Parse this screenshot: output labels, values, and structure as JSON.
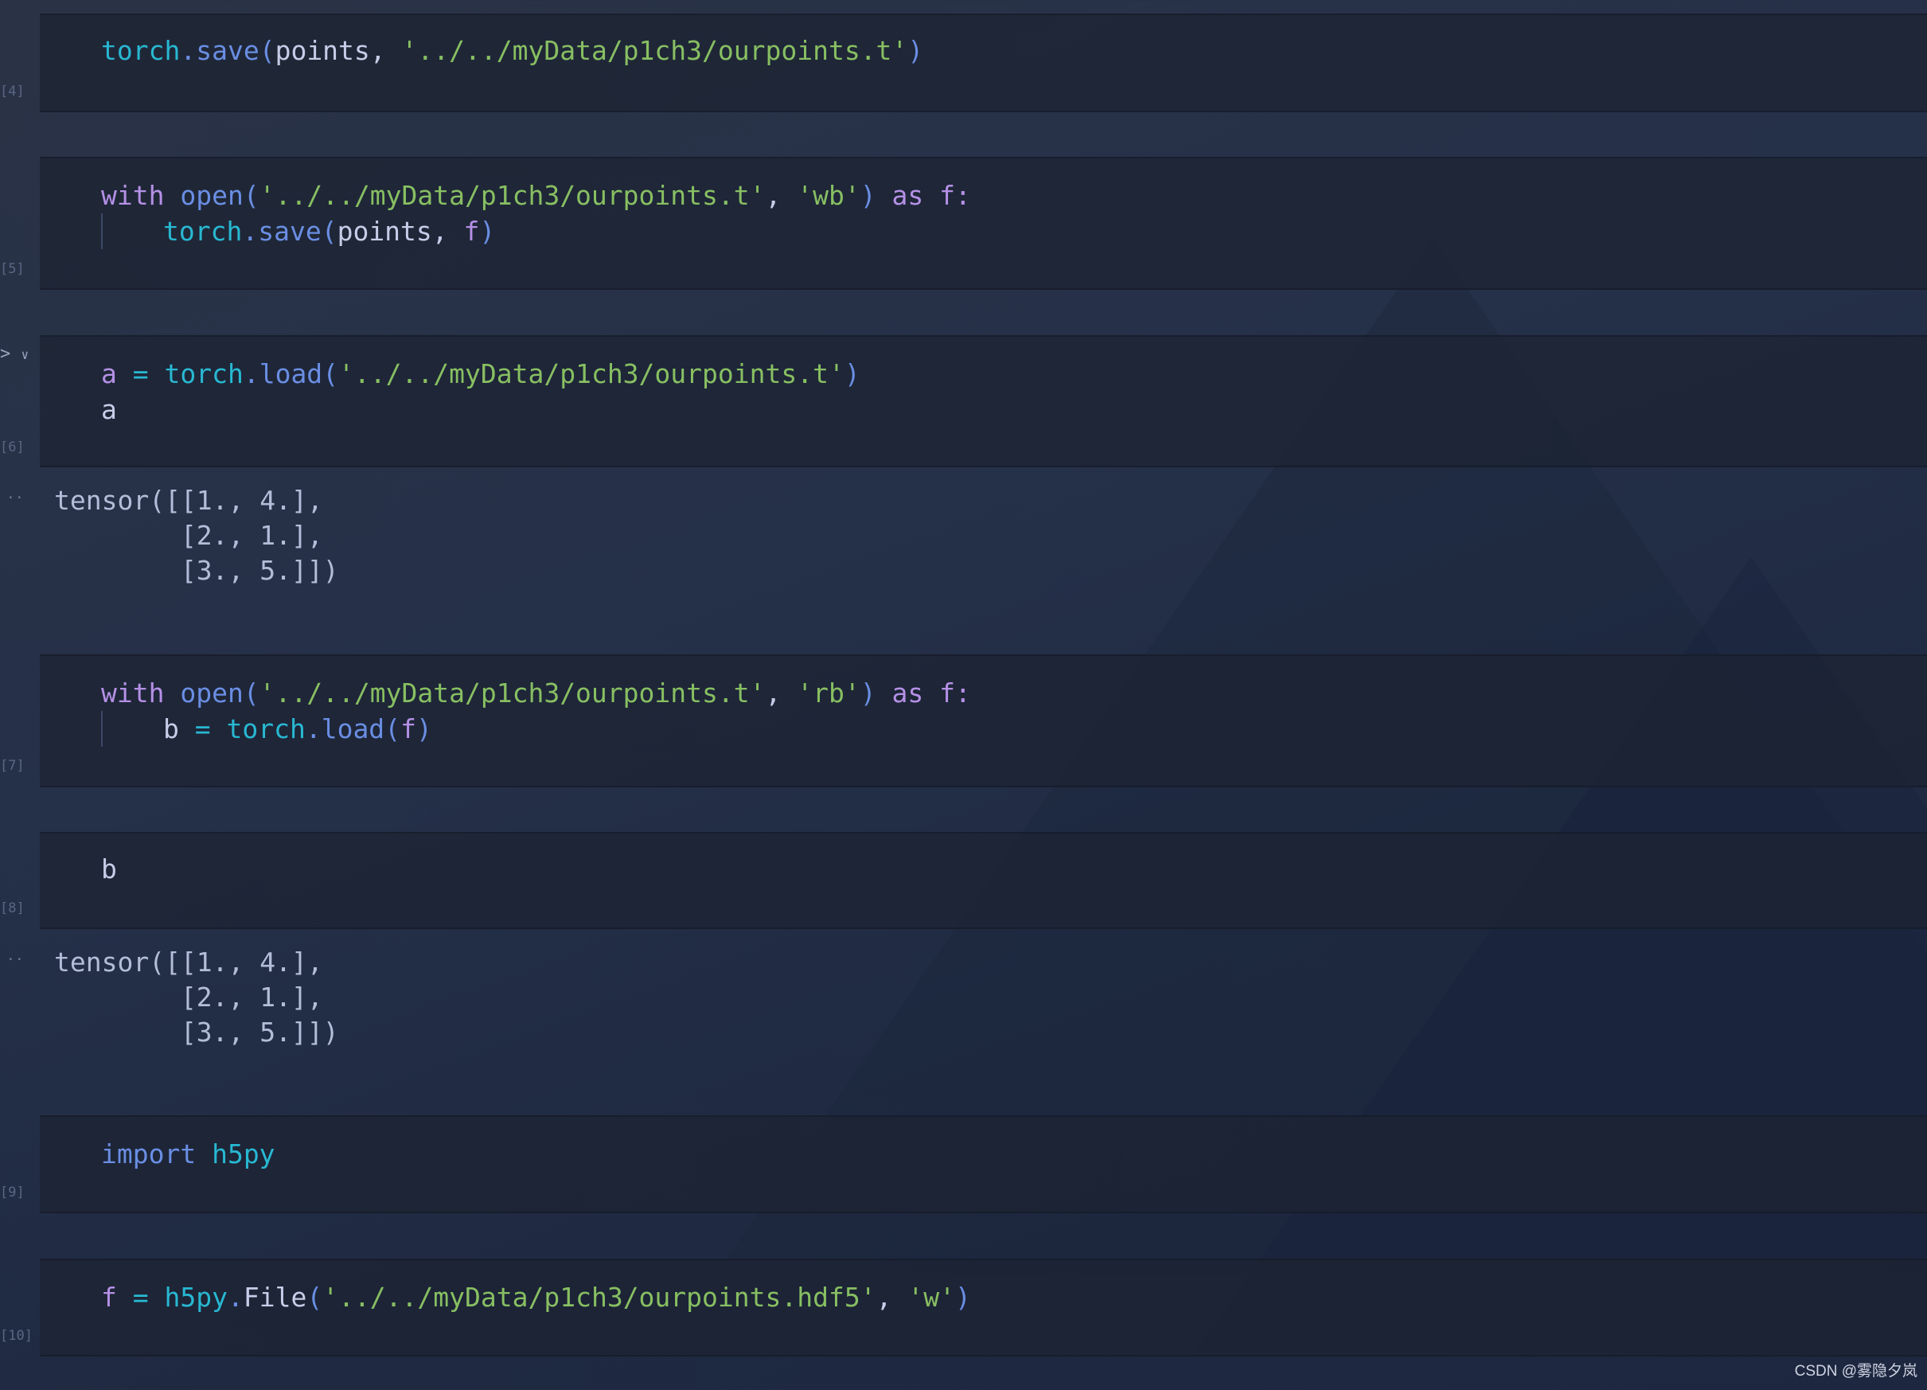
{
  "cells": [
    {
      "exec_count": "[4]",
      "lines": [
        [
          {
            "t": "torch",
            "c": "fn"
          },
          {
            "t": ".",
            "c": "meth"
          },
          {
            "t": "save",
            "c": "meth"
          },
          {
            "t": "(",
            "c": "punc"
          },
          {
            "t": "points, ",
            "c": "var"
          },
          {
            "t": "'../../myData/p1ch3/ourpoints.t'",
            "c": "str"
          },
          {
            "t": ")",
            "c": "punc"
          }
        ]
      ]
    },
    {
      "exec_count": "[5]",
      "lines": [
        [
          {
            "t": "with ",
            "c": "kw"
          },
          {
            "t": "open",
            "c": "meth"
          },
          {
            "t": "(",
            "c": "punc"
          },
          {
            "t": "'../../myData/p1ch3/ourpoints.t'",
            "c": "str"
          },
          {
            "t": ", ",
            "c": "var"
          },
          {
            "t": "'wb'",
            "c": "str"
          },
          {
            "t": ") ",
            "c": "punc"
          },
          {
            "t": "as ",
            "c": "kw"
          },
          {
            "t": "f:",
            "c": "fvar"
          }
        ],
        [
          {
            "t": "torch",
            "c": "fn"
          },
          {
            "t": ".",
            "c": "meth"
          },
          {
            "t": "save",
            "c": "meth"
          },
          {
            "t": "(",
            "c": "punc"
          },
          {
            "t": "points, ",
            "c": "var"
          },
          {
            "t": "f",
            "c": "fvar"
          },
          {
            "t": ")",
            "c": "punc"
          }
        ]
      ]
    },
    {
      "exec_count": "[6]",
      "lines": [
        [
          {
            "t": "a",
            "c": "fvar"
          },
          {
            "t": " = ",
            "c": "op"
          },
          {
            "t": "torch",
            "c": "fn"
          },
          {
            "t": ".",
            "c": "meth"
          },
          {
            "t": "load",
            "c": "meth"
          },
          {
            "t": "(",
            "c": "punc"
          },
          {
            "t": "'../../myData/p1ch3/ourpoints.t'",
            "c": "str"
          },
          {
            "t": ")",
            "c": "punc"
          }
        ],
        [
          {
            "t": "a",
            "c": "var"
          }
        ]
      ],
      "output": "tensor([[1., 4.],\n        [2., 1.],\n        [3., 5.]])"
    },
    {
      "exec_count": "[7]",
      "lines": [
        [
          {
            "t": "with ",
            "c": "kw"
          },
          {
            "t": "open",
            "c": "meth"
          },
          {
            "t": "(",
            "c": "punc"
          },
          {
            "t": "'../../myData/p1ch3/ourpoints.t'",
            "c": "str"
          },
          {
            "t": ", ",
            "c": "var"
          },
          {
            "t": "'rb'",
            "c": "str"
          },
          {
            "t": ") ",
            "c": "punc"
          },
          {
            "t": "as ",
            "c": "kw"
          },
          {
            "t": "f:",
            "c": "fvar"
          }
        ],
        [
          {
            "t": "b",
            "c": "var"
          },
          {
            "t": " = ",
            "c": "op"
          },
          {
            "t": "torch",
            "c": "fn"
          },
          {
            "t": ".",
            "c": "meth"
          },
          {
            "t": "load",
            "c": "meth"
          },
          {
            "t": "(",
            "c": "punc"
          },
          {
            "t": "f",
            "c": "fvar"
          },
          {
            "t": ")",
            "c": "punc"
          }
        ]
      ]
    },
    {
      "exec_count": "[8]",
      "lines": [
        [
          {
            "t": "b",
            "c": "var"
          }
        ]
      ],
      "output": "tensor([[1., 4.],\n        [2., 1.],\n        [3., 5.]])"
    },
    {
      "exec_count": "[9]",
      "lines": [
        [
          {
            "t": "import ",
            "c": "meth"
          },
          {
            "t": "h5py",
            "c": "fn"
          }
        ]
      ]
    },
    {
      "exec_count": "[10]",
      "lines": [
        [
          {
            "t": "f",
            "c": "fvar"
          },
          {
            "t": " = ",
            "c": "op"
          },
          {
            "t": "h5py",
            "c": "fn"
          },
          {
            "t": ".",
            "c": "meth"
          },
          {
            "t": "File",
            "c": "var"
          },
          {
            "t": "(",
            "c": "punc"
          },
          {
            "t": "'../../myData/p1ch3/ourpoints.hdf5'",
            "c": "str"
          },
          {
            "t": ", ",
            "c": "var"
          },
          {
            "t": "'w'",
            "c": "str"
          },
          {
            "t": ")",
            "c": "punc"
          }
        ]
      ]
    }
  ],
  "output_prefix": "··",
  "run_controls": {
    "run_icon": ">",
    "collapse_icon": "∨"
  },
  "watermark": "CSDN @雾隐夕岚"
}
